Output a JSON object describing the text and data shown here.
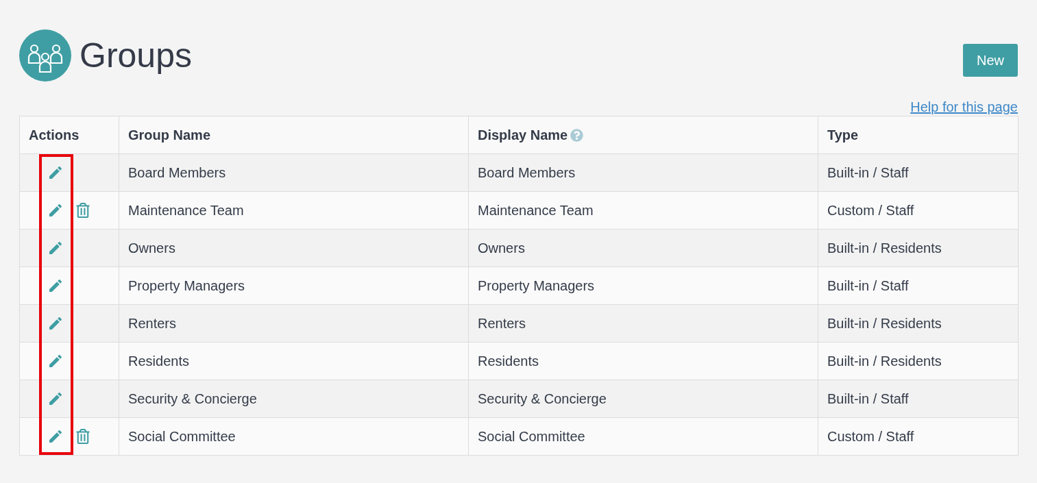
{
  "page": {
    "title": "Groups",
    "new_button": "New",
    "help_link": "Help for this page"
  },
  "table": {
    "columns": [
      {
        "label": "Actions",
        "help": false
      },
      {
        "label": "Group Name",
        "help": false
      },
      {
        "label": "Display Name",
        "help": true
      },
      {
        "label": "Type",
        "help": false
      }
    ],
    "rows": [
      {
        "group_name": "Board Members",
        "display_name": "Board Members",
        "type": "Built-in / Staff",
        "editable": true,
        "deletable": false
      },
      {
        "group_name": "Maintenance Team",
        "display_name": "Maintenance Team",
        "type": "Custom / Staff",
        "editable": true,
        "deletable": true
      },
      {
        "group_name": "Owners",
        "display_name": "Owners",
        "type": "Built-in / Residents",
        "editable": true,
        "deletable": false
      },
      {
        "group_name": "Property Managers",
        "display_name": "Property Managers",
        "type": "Built-in / Staff",
        "editable": true,
        "deletable": false
      },
      {
        "group_name": "Renters",
        "display_name": "Renters",
        "type": "Built-in / Residents",
        "editable": true,
        "deletable": false
      },
      {
        "group_name": "Residents",
        "display_name": "Residents",
        "type": "Built-in / Residents",
        "editable": true,
        "deletable": false
      },
      {
        "group_name": "Security & Concierge",
        "display_name": "Security & Concierge",
        "type": "Built-in / Staff",
        "editable": true,
        "deletable": false
      },
      {
        "group_name": "Social Committee",
        "display_name": "Social Committee",
        "type": "Custom / Staff",
        "editable": true,
        "deletable": true
      }
    ]
  },
  "annotation": {
    "highlight_edit_column": true
  }
}
